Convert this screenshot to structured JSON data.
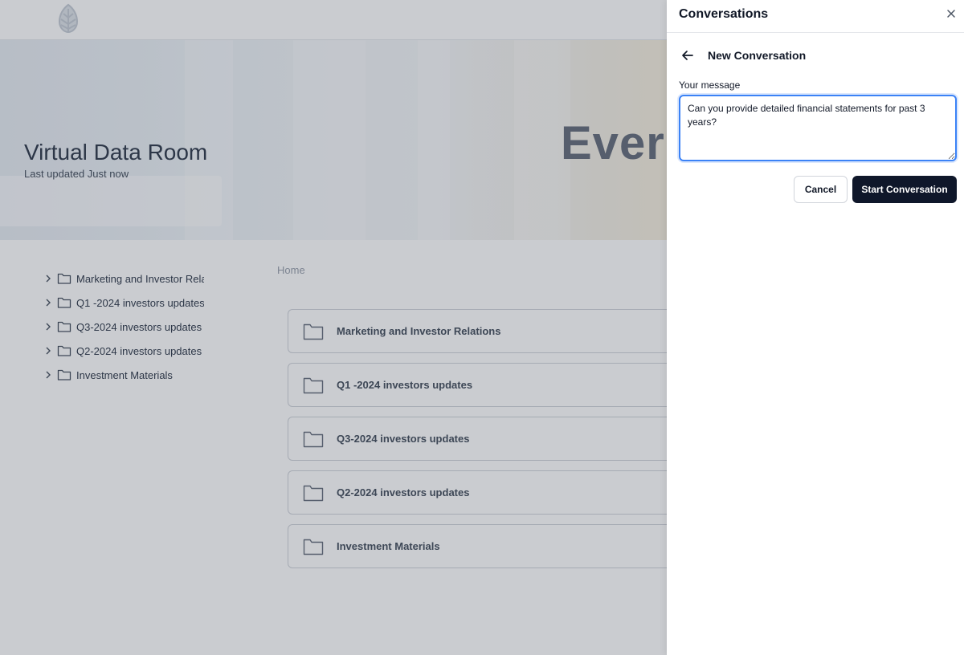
{
  "header": {
    "logo_icon": "pinecone-icon"
  },
  "hero": {
    "brand_text": "Everg",
    "title": "Virtual Data Room",
    "last_updated": "Last updated Just now"
  },
  "sidebar": {
    "items": [
      {
        "label": "Marketing and Investor Relations"
      },
      {
        "label": "Q1 -2024 investors updates"
      },
      {
        "label": "Q3-2024 investors updates"
      },
      {
        "label": "Q2-2024 investors updates"
      },
      {
        "label": "Investment Materials"
      }
    ]
  },
  "main": {
    "breadcrumb": "Home",
    "folders": [
      {
        "label": "Marketing and Investor Relations"
      },
      {
        "label": "Q1 -2024 investors updates"
      },
      {
        "label": "Q3-2024 investors updates"
      },
      {
        "label": "Q2-2024 investors updates"
      },
      {
        "label": "Investment Materials"
      }
    ]
  },
  "drawer": {
    "title": "Conversations",
    "subtitle": "New Conversation",
    "message_label": "Your message",
    "message_value": "Can you provide detailed financial statements for past 3 years?",
    "cancel_label": "Cancel",
    "start_label": "Start Conversation"
  },
  "colors": {
    "accent": "#3b82f6",
    "primary_button": "#0f172a",
    "overlay": "rgba(15,23,42,0.22)"
  }
}
